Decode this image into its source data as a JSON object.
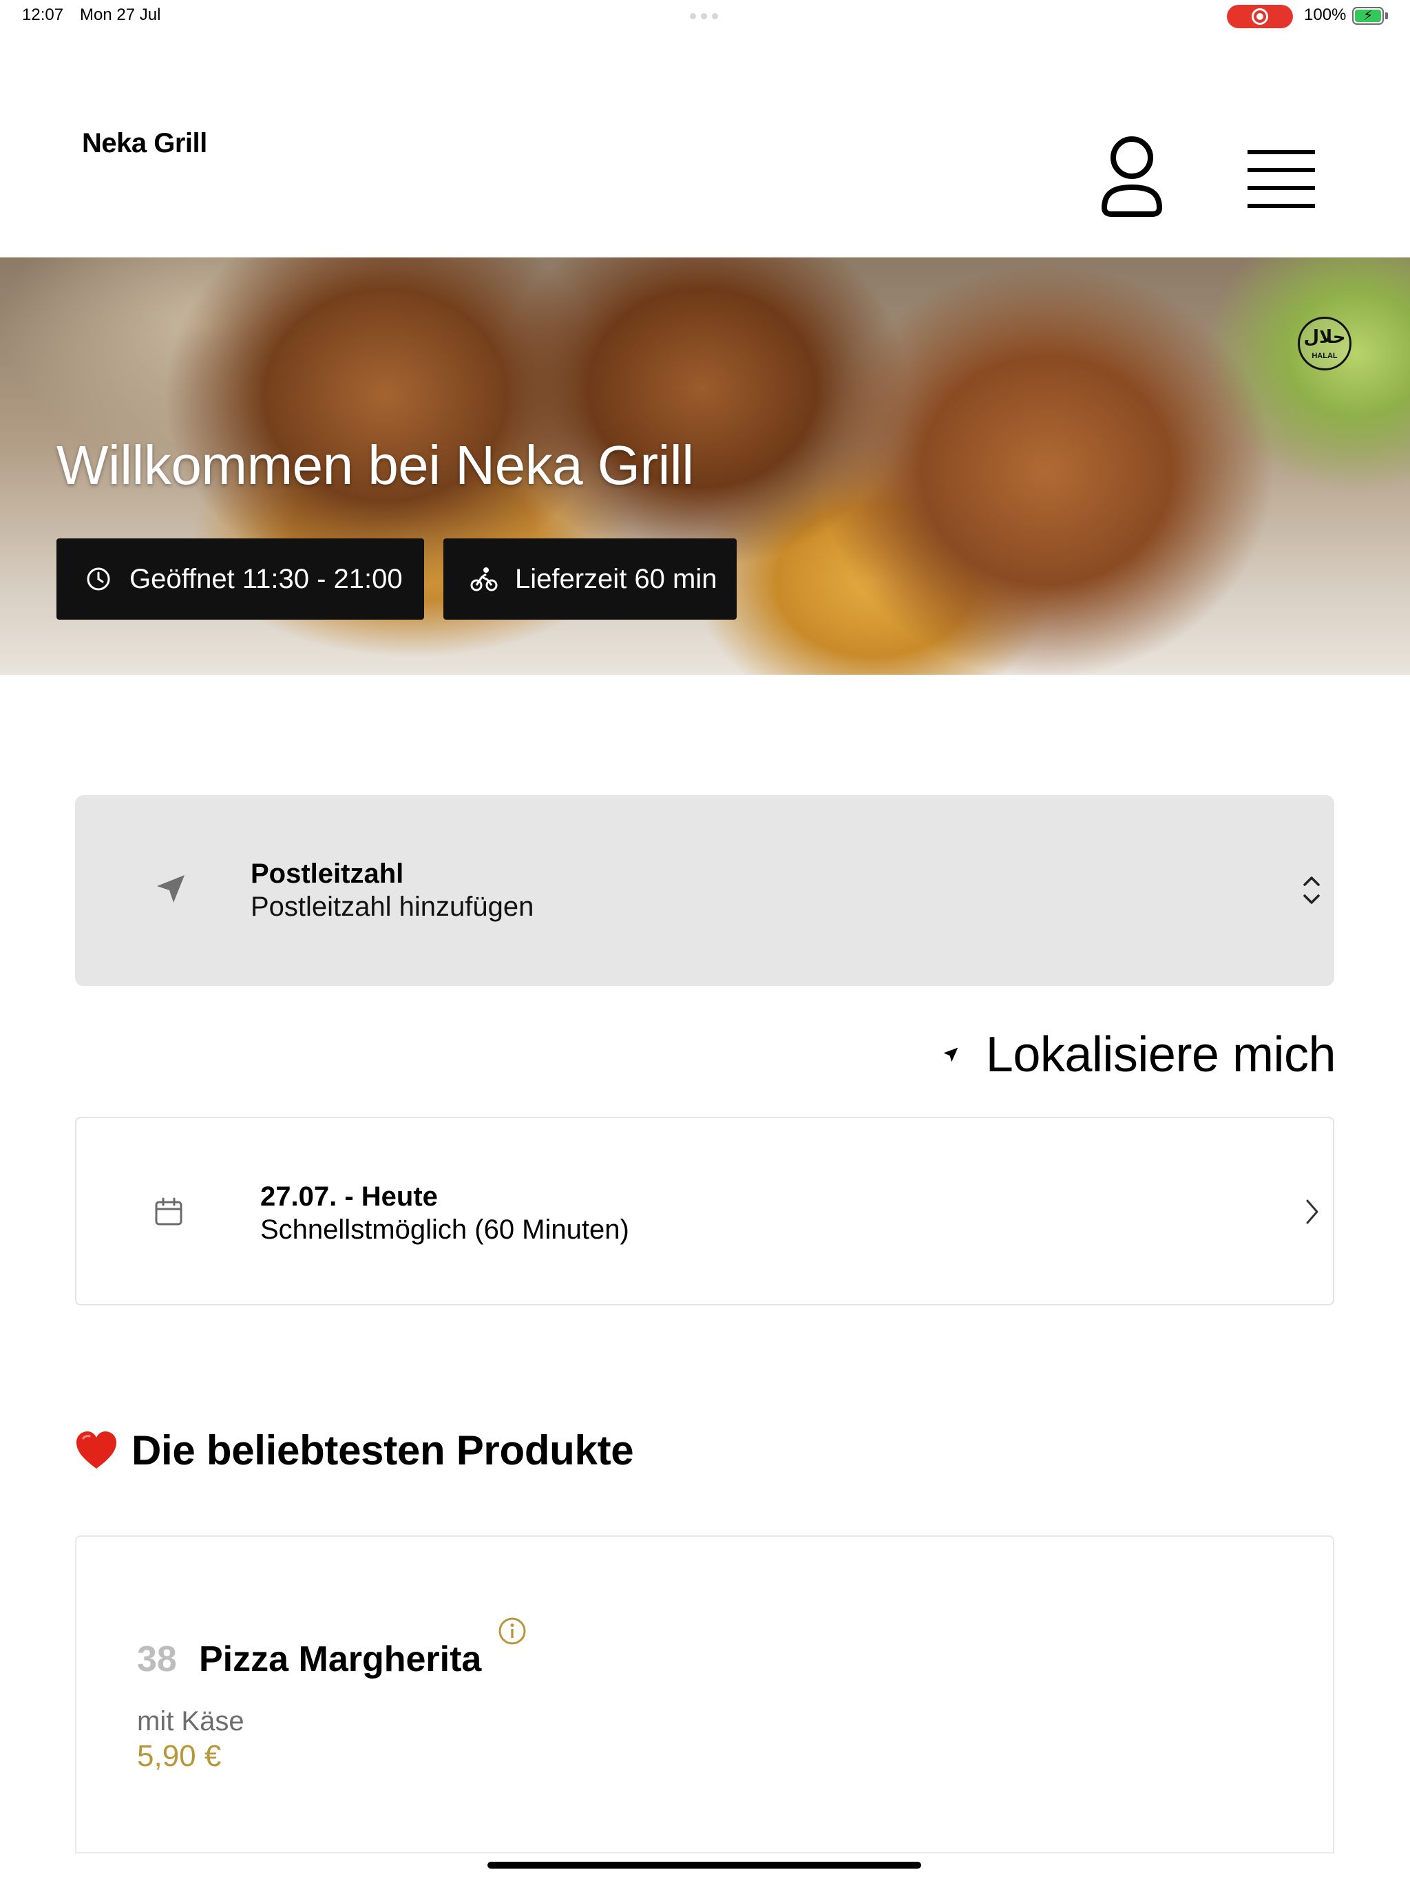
{
  "status_bar": {
    "time": "12:07",
    "date": "Mon 27 Jul",
    "battery": "100%",
    "record_color": "#e5352b"
  },
  "header": {
    "brand": "Neka Grill",
    "account_icon": "user-icon",
    "menu_icon": "hamburger-menu-icon"
  },
  "hero": {
    "title": "Willkommen bei Neka Grill",
    "halal_badge": {
      "arabic": "حلال",
      "latin": "HALAL"
    },
    "chips": {
      "open": {
        "icon": "clock-icon",
        "label": "Geöffnet 11:30 - 21:00"
      },
      "delivery": {
        "icon": "bicycle-icon",
        "label": "Lieferzeit 60 min"
      }
    }
  },
  "postal": {
    "label": "Postleitzahl",
    "value": "Postleitzahl hinzufügen",
    "icon": "location-arrow-icon"
  },
  "locate": {
    "label": "Lokalisiere mich",
    "icon": "location-arrow-icon"
  },
  "delivery_time": {
    "label": "27.07. - Heute",
    "value": "Schnellstmöglich (60 Minuten)",
    "icon": "calendar-icon"
  },
  "popular": {
    "title": "Die beliebtesten Produkte",
    "icon": "heart-icon",
    "products": [
      {
        "number": "38",
        "name": "Pizza Margherita",
        "description": "mit Käse",
        "price": "5,90 €"
      }
    ]
  },
  "colors": {
    "accent_gold": "#b8973b",
    "chip_bg": "#111111",
    "card_grey": "#e6e6e6"
  }
}
